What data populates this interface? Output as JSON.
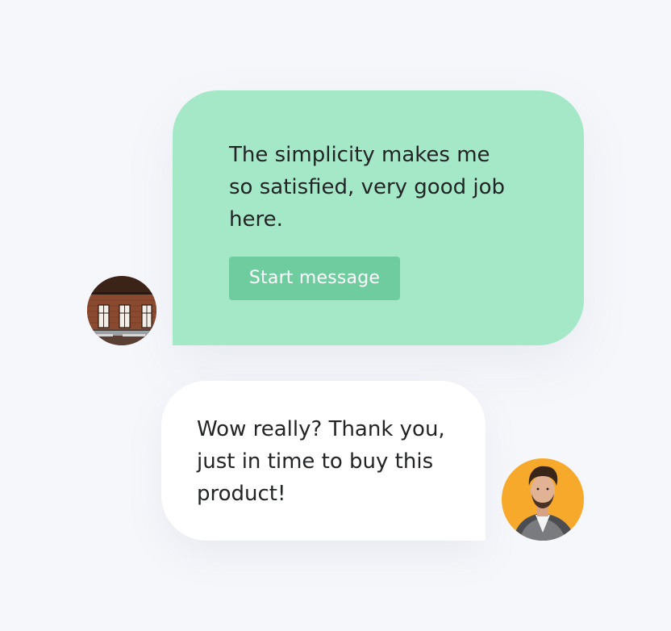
{
  "conversation": {
    "messages": [
      {
        "sender": "left",
        "text": "The simplicity makes me so satisfied, very good job here.",
        "button_label": "Start message",
        "bubble_color": "#a4e8c8",
        "button_color": "#6fcc9f"
      },
      {
        "sender": "right",
        "text": "Wow really? Thank you, just in time to buy this product!",
        "bubble_color": "#ffffff"
      }
    ],
    "avatars": {
      "left": {
        "image": "office-interior-photo"
      },
      "right": {
        "image": "man-portrait-photo",
        "background": "#f7a92c"
      }
    }
  },
  "colors": {
    "page_background": "#f6f7fb",
    "text": "#222426"
  }
}
